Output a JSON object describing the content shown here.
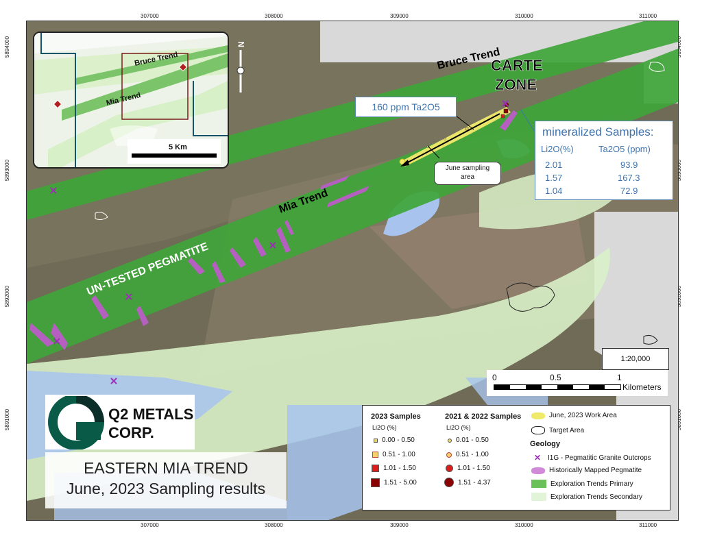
{
  "map": {
    "grid_x_ticks": [
      "307000",
      "308000",
      "309000",
      "310000",
      "311000"
    ],
    "grid_y_ticks": [
      "5894000",
      "5893000",
      "5892000",
      "5891000"
    ],
    "labels": {
      "bruce_trend": "Bruce Trend",
      "mia_trend": "Mia Trend",
      "carte_zone_line1": "CARTE",
      "carte_zone_line2": "ZONE",
      "untested": "UN-TESTED PEGMATITE"
    },
    "callout_ta": "160 ppm Ta2O5",
    "callout_june": [
      "June sampling",
      "area"
    ],
    "samples_box": {
      "title": "mineralized Samples:",
      "headers": [
        "Li2O(%)",
        "Ta2O5 (ppm)"
      ],
      "rows": [
        [
          "2.01",
          "93.9"
        ],
        [
          "1.57",
          "167.3"
        ],
        [
          "1.04",
          "72.9"
        ]
      ]
    },
    "scale": {
      "ratio": "1:20,000",
      "ticks": [
        "0",
        "0.5",
        "1"
      ],
      "unit": "Kilometers"
    },
    "north_label": "N",
    "colors": {
      "trend_primary": "#3fa53a",
      "trend_secondary": "#d8f0c8",
      "water": "#a8c4ee",
      "pegmatite": "#b560c0",
      "outcrop_x": "#9b2fb5",
      "work_area": "#f0ea6a",
      "callout_text": "#3f74ad"
    }
  },
  "inset": {
    "bruce_trend": "Bruce Trend",
    "mia_trend": "Mia Trend",
    "scale_label": "5 Km"
  },
  "legend": {
    "col1_title": "2023 Samples",
    "col2_title": "2021 & 2022 Samples",
    "unit": "Li2O (%)",
    "samples_2023": [
      "0.00 - 0.50",
      "0.51 - 1.00",
      "1.01 - 1.50",
      "1.51 - 5.00"
    ],
    "samples_2122": [
      "0.01 - 0.50",
      "0.51 - 1.00",
      "1.01 - 1.50",
      "1.51 - 4.37"
    ],
    "work_area": "June, 2023 Work Area",
    "target_area": "Target Area",
    "geology_title": "Geology",
    "outcrops": "I1G - Pegmatitic Granite Outcrops",
    "pegmatite": "Historically Mapped Pegmatite",
    "primary": "Exploration Trends Primary",
    "secondary": "Exploration Trends Secondary"
  },
  "logo": {
    "line1": "Q2 METALS",
    "line2": "CORP."
  },
  "title": {
    "line1": "EASTERN MIA TREND",
    "line2": "June, 2023 Sampling results"
  }
}
